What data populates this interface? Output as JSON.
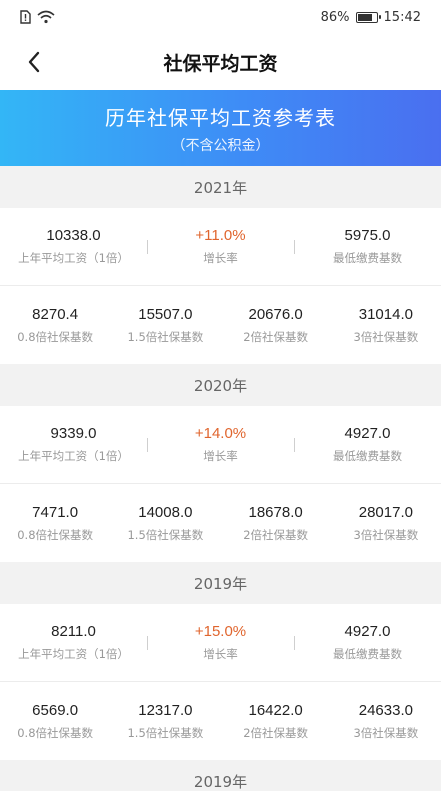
{
  "status": {
    "battery": "86%",
    "battery_level": 0.86,
    "time": "15:42"
  },
  "nav": {
    "title": "社保平均工资"
  },
  "banner": {
    "title": "历年社保平均工资参考表",
    "subtitle": "（不含公积金）"
  },
  "labels": {
    "avg_wage": "上年平均工资（1倍）",
    "growth": "增长率",
    "min_base": "最低缴费基数",
    "b08": "0.8倍社保基数",
    "b15": "1.5倍社保基数",
    "b2": "2倍社保基数",
    "b3": "3倍社保基数"
  },
  "years": [
    {
      "year": "2021年",
      "avg": "10338.0",
      "growth": "+11.0%",
      "min": "5975.0",
      "b08": "8270.4",
      "b15": "15507.0",
      "b2": "20676.0",
      "b3": "31014.0"
    },
    {
      "year": "2020年",
      "avg": "9339.0",
      "growth": "+14.0%",
      "min": "4927.0",
      "b08": "7471.0",
      "b15": "14008.0",
      "b2": "18678.0",
      "b3": "28017.0"
    },
    {
      "year": "2019年",
      "avg": "8211.0",
      "growth": "+15.0%",
      "min": "4927.0",
      "b08": "6569.0",
      "b15": "12317.0",
      "b2": "16422.0",
      "b3": "24633.0"
    },
    {
      "year": "2019年"
    }
  ]
}
